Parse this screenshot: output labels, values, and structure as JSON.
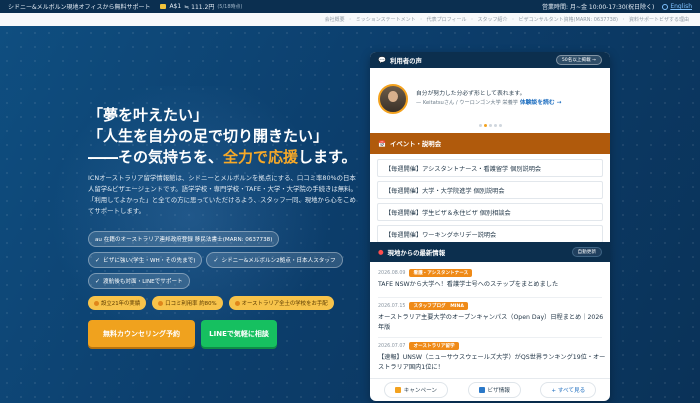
{
  "topbar": {
    "tagline": "シドニー&メルボルン現地オフィスから無料サポート",
    "rate_label": "A$1",
    "rate_value": "≒ 111.2円",
    "rate_note": "(5/18時点)",
    "hours": "営業時間: 月~金 10:00-17:30(祝日除く)",
    "language": "English"
  },
  "nav": {
    "items": [
      "会社概要",
      "ミッションステートメント",
      "代表プロフィール",
      "スタッフ紹介",
      "ビザコンサルタント資格(MARN: 0637738)",
      "資料サポートビザする理由"
    ]
  },
  "hero": {
    "line1": "「夢を叶えたい」",
    "line2": "「人生を自分の足で切り開きたい」",
    "line3_pre": "――その気持ちを、",
    "line3_accent": "全力で応援",
    "line3_post": "します。",
    "description": "ICNオーストラリア留学情報館は、シドニーとメルボルンを拠点にする、口コミ率80%の日本人留学&ビザエージェントです。語学学校・専門学校・TAFE・大学・大学院の手続きは無料。「利用してよかった」と全ての方に思っていただけるよう、スタッフ一同、現地から心をこめてサポートします。",
    "pills": [
      "au 在籍のオーストラリア連邦政府登録 移民法書士(MARN: 0637738)",
      "ビザに強い(学生・WH・その先まで)",
      "シドニー&メルボルン2拠点・日本人スタッフ",
      "渡航後も対面・LINEでサポート"
    ],
    "badges": [
      "設立21年の実績",
      "口コミ利用率 約80%",
      "オーストラリア全土の学校をお手配"
    ],
    "cta_primary": "無料カウンセリング予約",
    "cta_line": "LINEで気軽に相談"
  },
  "panel": {
    "voice": {
      "heading": "利用者の声",
      "more": "50名以上掲載 →",
      "quote": "自分が努力した分必ず形として表れます。",
      "author": "— Keitatsuさん / ウーロンゴン大学 栄養学",
      "link": "体験談を読む →"
    },
    "events": {
      "heading": "イベント・説明会",
      "items": [
        "【毎週開催】アシスタントナース・看護留学 個別説明会",
        "【毎週開催】大学・大学院進学 個別説明会",
        "【毎週開催】学生ビザ＆永住ビザ 個別相談会",
        "【毎週開催】ワーキングホリデー説明会"
      ]
    },
    "news": {
      "heading": "現地からの最新情報",
      "badge": "自動更新",
      "items": [
        {
          "date": "2026.08.09",
          "tag": "看護・アシスタントナース",
          "title": "TAFE NSWから大学へ！看護学士号へのステップをまとめました"
        },
        {
          "date": "2026.07.15",
          "tag": "スタッフブログ　MINA",
          "title": "オーストラリア主要大学のオープンキャンパス（Open Day）日程まとめ｜2026年版"
        },
        {
          "date": "2026.07.07",
          "tag": "オーストラリア留学",
          "title": "【速報】UNSW（ニューサウスウェールズ大学）がQS世界ランキング19位・オーストラリア国内1位に！"
        }
      ]
    },
    "footer": {
      "campaign": "キャンペーン",
      "visa": "ビザ情報",
      "all": "+ すべて見る"
    }
  }
}
